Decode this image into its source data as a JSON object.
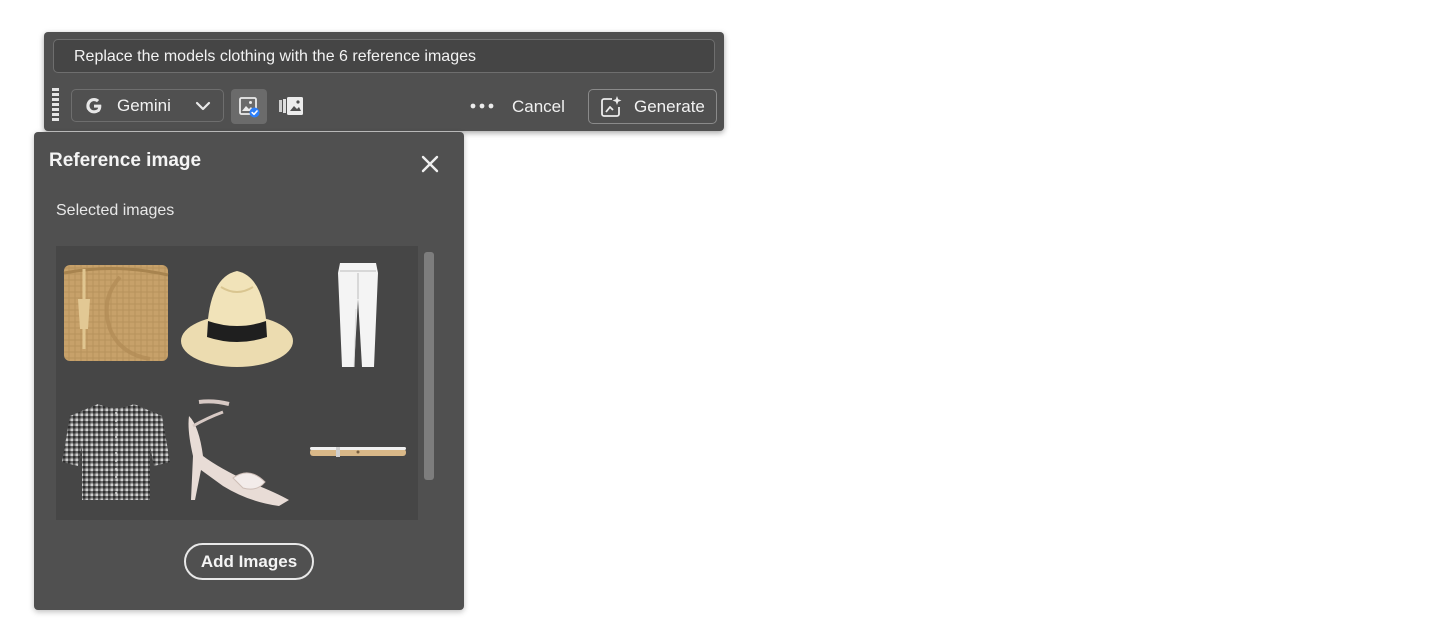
{
  "prompt": {
    "text": "Replace the models clothing with the 6 reference images"
  },
  "toolbar": {
    "model_label": "Gemini",
    "cancel_label": "Cancel",
    "generate_label": "Generate"
  },
  "panel": {
    "title": "Reference image",
    "section_label": "Selected images",
    "add_button_label": "Add Images",
    "images": [
      {
        "icon": "straw-clutch-bag"
      },
      {
        "icon": "straw-fedora-hat"
      },
      {
        "icon": "white-jeans"
      },
      {
        "icon": "gingham-blouse"
      },
      {
        "icon": "strappy-heel-sandal"
      },
      {
        "icon": "thin-belt"
      }
    ]
  },
  "colors": {
    "panel_bg": "#505050",
    "selected_toggle_bg": "#6b6b6b",
    "accent_blue": "#2d7ff9",
    "page_bg": "#ffffff"
  }
}
